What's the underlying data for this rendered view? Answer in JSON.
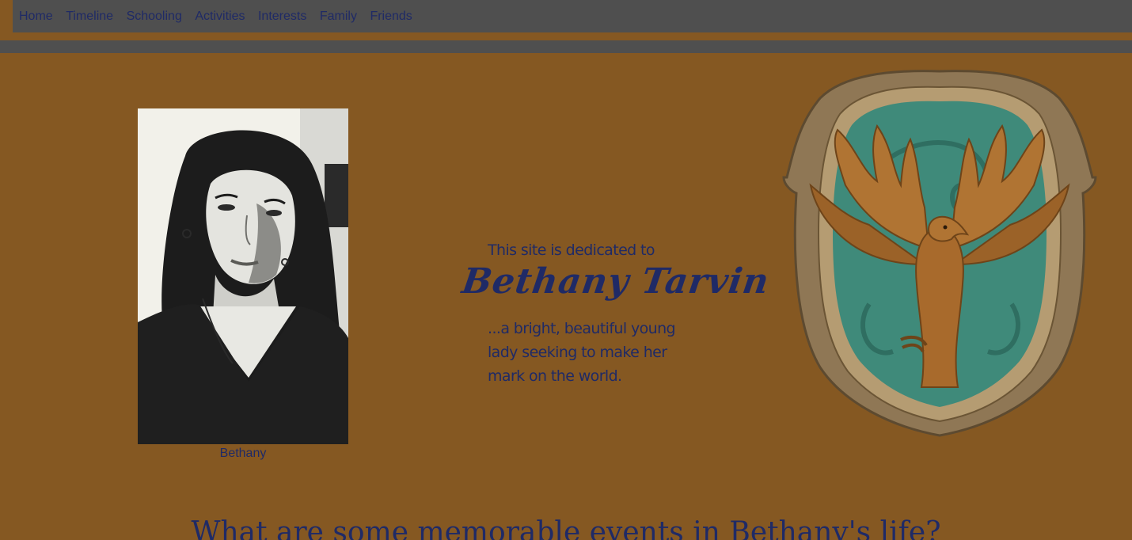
{
  "nav": {
    "items": [
      {
        "label": "Home"
      },
      {
        "label": "Timeline"
      },
      {
        "label": "Schooling"
      },
      {
        "label": "Activities"
      },
      {
        "label": "Interests"
      },
      {
        "label": "Family"
      },
      {
        "label": "Friends"
      }
    ]
  },
  "hero": {
    "portrait_caption": "Bethany",
    "dedicated_text": "This site is dedicated to",
    "name": "Bethany  Tarvin",
    "tagline": "...a bright, beautiful young lady seeking to make her mark on the world."
  },
  "section": {
    "heading": "What are some memorable events in Bethany's life?"
  },
  "colors": {
    "background": "#855822",
    "navbar": "#4f4f4f",
    "text": "#1f2a66",
    "crest_teal": "#3f8a7a",
    "crest_bronze": "#a9783d"
  },
  "icons": {
    "crest": "eagle-house-crest-icon",
    "portrait": "portrait-photo"
  }
}
